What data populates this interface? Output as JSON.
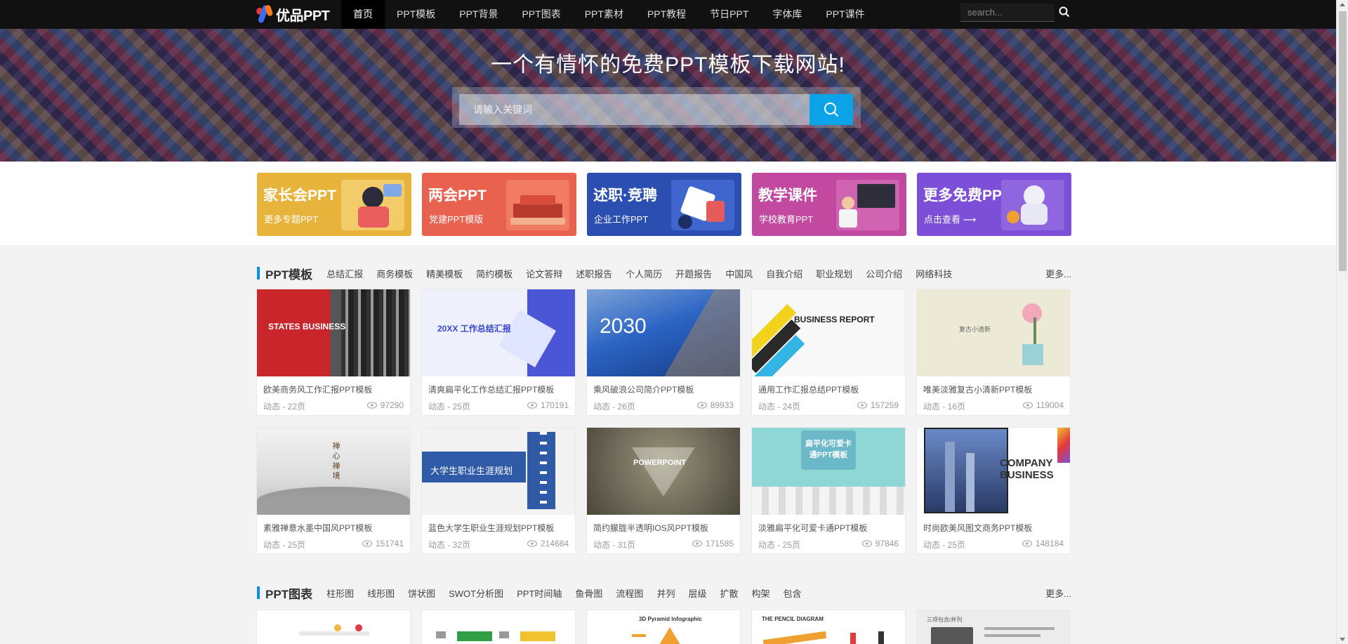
{
  "header": {
    "logo_text": "优品PPT",
    "nav": [
      "首页",
      "PPT模板",
      "PPT背景",
      "PPT图表",
      "PPT素材",
      "PPT教程",
      "节日PPT",
      "字体库",
      "PPT课件"
    ],
    "search_placeholder": "search..."
  },
  "hero": {
    "title": "一个有情怀的免费PPT模板下载网站!",
    "search_placeholder": "请输入关键词"
  },
  "features": [
    {
      "title": "家长会PPT",
      "sub": "更多专题PPT",
      "color": "#e8b33a"
    },
    {
      "title": "两会PPT",
      "sub": "党建PPT模版",
      "color": "#e9614f"
    },
    {
      "title": "述职·竞聘",
      "sub": "企业工作PPT",
      "color": "#2a4fb0"
    },
    {
      "title": "教学课件",
      "sub": "学校教育PPT",
      "color": "#c14aa0"
    },
    {
      "title": "更多免费PPT",
      "sub": "点击查看 ⟶",
      "color": "#7d4fd6"
    }
  ],
  "templates": {
    "title": "PPT模板",
    "tags": [
      "总结汇报",
      "商务模板",
      "精美模板",
      "简约模板",
      "论文答辩",
      "述职报告",
      "个人简历",
      "开题报告",
      "中国风",
      "自我介绍",
      "职业规划",
      "公司介绍",
      "网络科技"
    ],
    "more": "更多...",
    "items": [
      {
        "name": "欧美商务风工作汇报PPT模板",
        "meta": "动态 - 22页",
        "views": "97290",
        "thumb_text": "STATES BUSINESS",
        "bg": "#c8262b"
      },
      {
        "name": "清爽扁平化工作总结汇报PPT模板",
        "meta": "动态 - 25页",
        "views": "170191",
        "thumb_text": "20XX 工作总结汇报",
        "bg": "#eef1fb"
      },
      {
        "name": "乘风破浪公司简介PPT模板",
        "meta": "动态 - 26页",
        "views": "89933",
        "thumb_text": "2030",
        "bg": "#2b64c4"
      },
      {
        "name": "通用工作汇报总结PPT模板",
        "meta": "动态 - 24页",
        "views": "157259",
        "thumb_text": "BUSINESS REPORT",
        "bg": "#f8f8f8"
      },
      {
        "name": "唯美淡雅复古小清新PPT模板",
        "meta": "动态 - 16页",
        "views": "119004",
        "thumb_text": "复古小清新",
        "bg": "#ece9d6"
      },
      {
        "name": "素雅禅意水墨中国风PPT模板",
        "meta": "动态 - 25页",
        "views": "151741",
        "thumb_text": "禅 心 禅 境",
        "bg": "#e4e4e4"
      },
      {
        "name": "蓝色大学生职业生涯规划PPT模板",
        "meta": "动态 - 32页",
        "views": "214684",
        "thumb_text": "大学生职业生涯规划",
        "bg": "#f2f2f2"
      },
      {
        "name": "简约朦胧半透明IOS风PPT模板",
        "meta": "动态 - 31页",
        "views": "171585",
        "thumb_text": "POWERPOINT",
        "bg": "#6e6a5a"
      },
      {
        "name": "淡雅扁平化可爱卡通PPT模板",
        "meta": "动态 - 25页",
        "views": "97846",
        "thumb_text": "扁平化可爱卡通PPT模板",
        "bg": "#8fd6d6"
      },
      {
        "name": "时尚欧美风图文商务PPT模板",
        "meta": "动态 - 25页",
        "views": "148184",
        "thumb_text": "COMPANY BUSINESS",
        "bg": "#ffffff"
      }
    ]
  },
  "charts": {
    "title": "PPT图表",
    "tags": [
      "柱形图",
      "线形图",
      "饼状图",
      "SWOT分析图",
      "PPT时间轴",
      "鱼骨图",
      "流程图",
      "并列",
      "层级",
      "扩散",
      "构架",
      "包含"
    ],
    "more": "更多...",
    "items": [
      {
        "caption": ""
      },
      {
        "caption": ""
      },
      {
        "caption": "3D Pyramid Infographic"
      },
      {
        "caption": "THE PENCIL DIAGRAM"
      },
      {
        "caption": "三项包含/并列"
      }
    ]
  }
}
